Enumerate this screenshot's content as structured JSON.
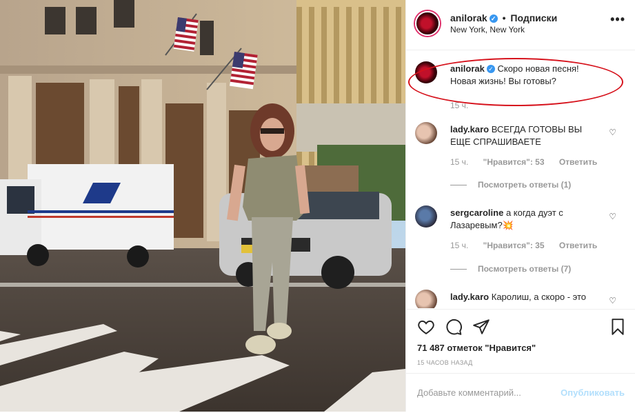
{
  "post": {
    "username": "anilorak",
    "follow_label": "Подписки",
    "separator": "•",
    "location": "New York, New York",
    "more_label": "•••"
  },
  "caption": {
    "username": "anilorak",
    "text": "Скоро новая песня! Новая жизнь! Вы готовы?",
    "time": "15 ч."
  },
  "comments": [
    {
      "username": "lady.karo",
      "text": "ВСЕГДА ГОТОВЫ ВЫ ЕЩЕ СПРАШИВАЕТЕ",
      "time": "15 ч.",
      "likes": "\"Нравится\": 53",
      "reply": "Ответить",
      "view_replies": "Посмотреть ответы (1)"
    },
    {
      "username": "sergcaroline",
      "text": "а когда дуэт с Лазаревым?💥",
      "time": "15 ч.",
      "likes": "\"Нравится\": 35",
      "reply": "Ответить",
      "view_replies": "Посмотреть ответы (7)"
    },
    {
      "username": "lady.karo",
      "text": "Каролиш, а скоро - это"
    }
  ],
  "likes_count": "71 487 отметок \"Нравится\"",
  "time_ago": "15 ЧАСОВ НАЗАД",
  "add_comment": {
    "placeholder": "Добавьте комментарий...",
    "post_label": "Опубликовать"
  },
  "colors": {
    "accent": "#3897f0",
    "highlight": "#d6111b",
    "muted": "#999999"
  }
}
